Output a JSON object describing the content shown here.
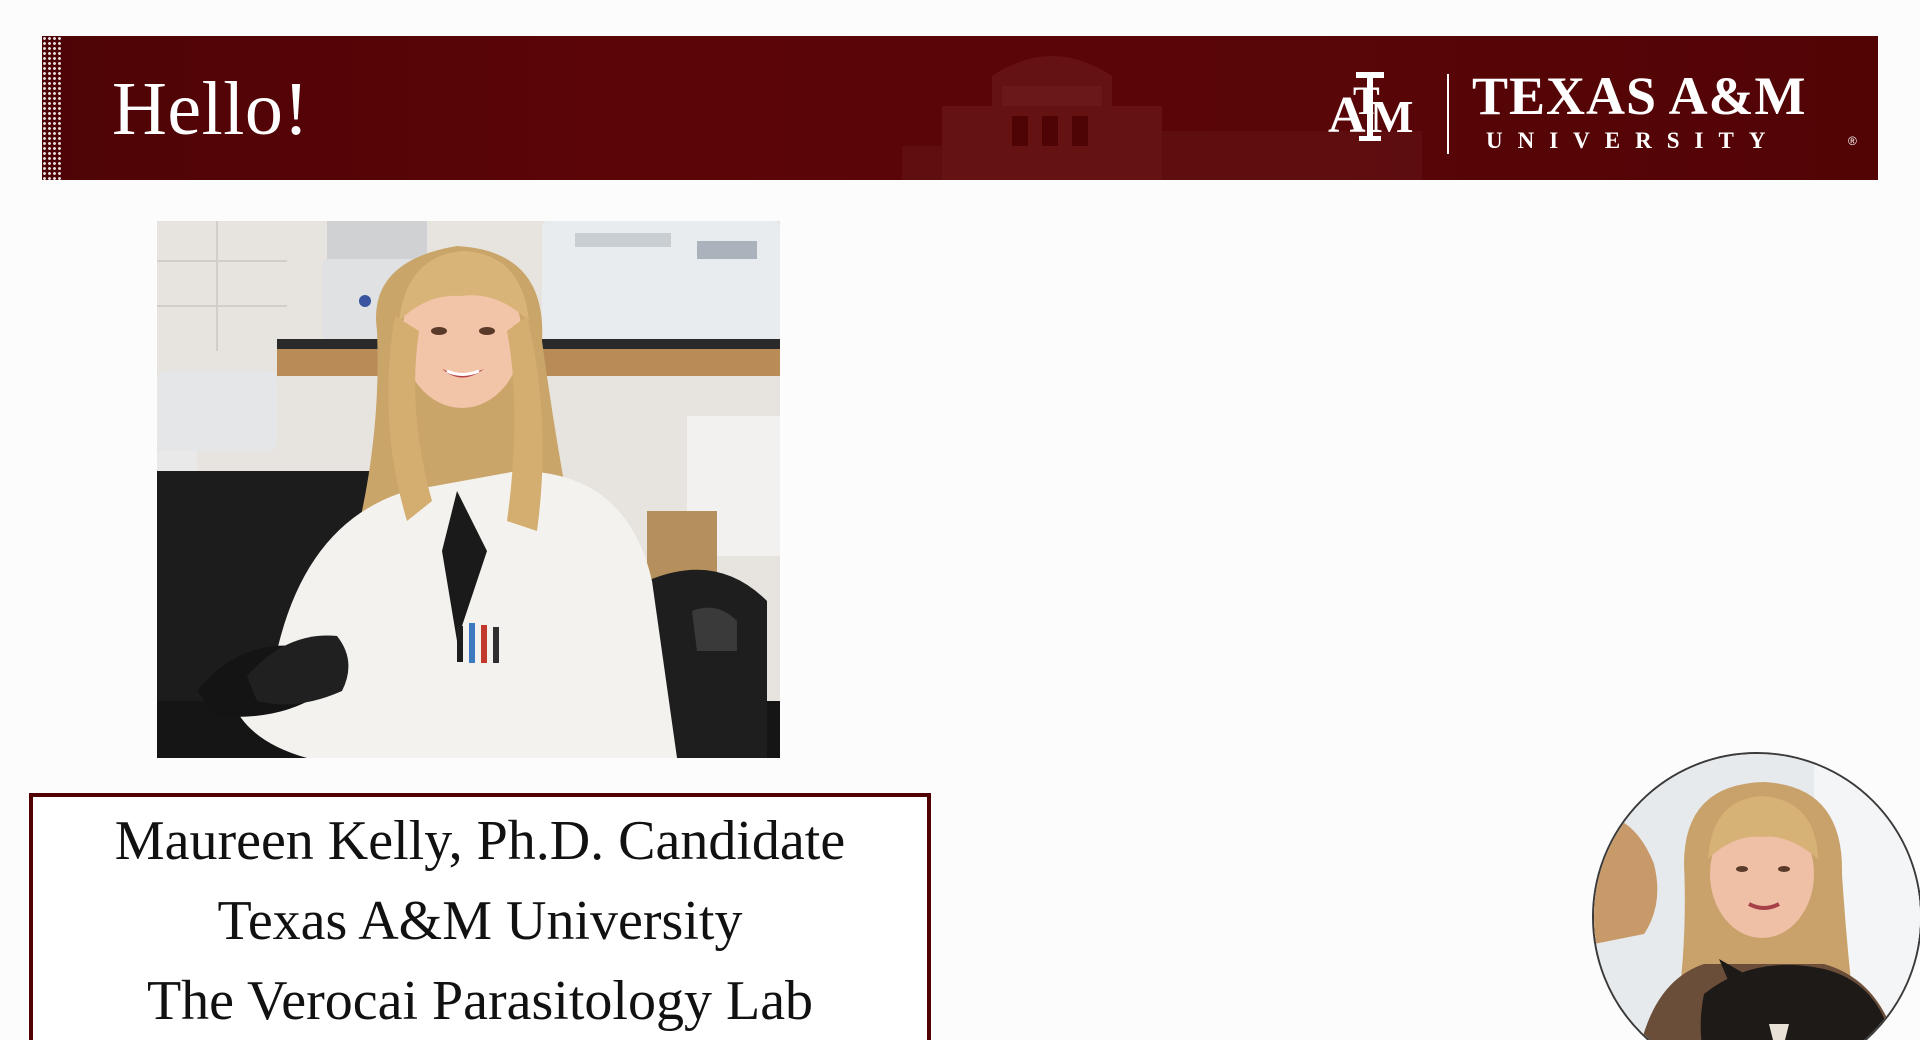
{
  "slide": {
    "title": "Hello!",
    "logo": {
      "mark": "ATM",
      "name": "TEXAS A&M",
      "subtitle": "UNIVERSITY",
      "registered": "®"
    },
    "name_card": {
      "line1": "Maureen Kelly, Ph.D. Candidate",
      "line2": "Texas A&M University",
      "line3": "The Verocai Parasitology Lab"
    },
    "portrait_icon": "portrait-photo",
    "webcam_icon": "webcam-feed"
  },
  "colors": {
    "maroon": "#500000",
    "banner": "#5a0608",
    "white": "#ffffff"
  }
}
